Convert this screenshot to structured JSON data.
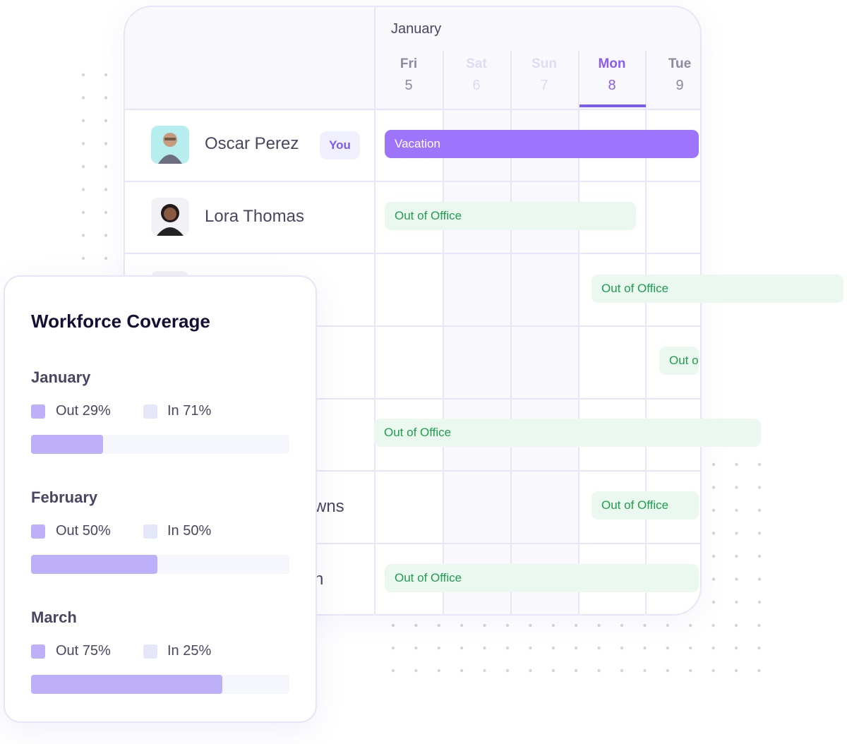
{
  "calendar": {
    "month": "January",
    "days": [
      {
        "name": "Fri",
        "date": "5",
        "type": "weekday"
      },
      {
        "name": "Sat",
        "date": "6",
        "type": "weekend"
      },
      {
        "name": "Sun",
        "date": "7",
        "type": "weekend"
      },
      {
        "name": "Mon",
        "date": "8",
        "type": "today"
      },
      {
        "name": "Tue",
        "date": "9",
        "type": "weekday"
      }
    ],
    "you_badge": "You",
    "people": [
      {
        "name": "Oscar Perez",
        "avatar_bg": "#b6eef0",
        "event": "Vacation",
        "event_type": "vacation"
      },
      {
        "name": "Lora Thomas",
        "avatar_bg": "#f1f1f6",
        "event": "Out of Office",
        "event_type": "ooo"
      },
      {
        "name": "",
        "event": "Out of Office",
        "event_type": "ooo"
      },
      {
        "name": "",
        "event": "Out of Office",
        "event_type": "ooo"
      },
      {
        "name": "",
        "event": "Out of Office",
        "event_type": "ooo"
      },
      {
        "name": "wns",
        "event": "Out of Office",
        "event_type": "ooo"
      },
      {
        "name": "n",
        "event": "Out of Office",
        "event_type": "ooo"
      }
    ]
  },
  "coverage": {
    "title": "Workforce Coverage",
    "months": [
      {
        "label": "January",
        "out_label": "Out 29%",
        "in_label": "In 71%",
        "out_pct": 29
      },
      {
        "label": "February",
        "out_label": "Out 50%",
        "in_label": "In 50%",
        "out_pct": 50
      },
      {
        "label": "March",
        "out_label": "Out 75%",
        "in_label": "In 25%",
        "out_pct": 75
      }
    ]
  },
  "colors": {
    "accent": "#8b5cf6",
    "vacation": "#9d74fb",
    "ooo_bg": "#ebf8f0",
    "ooo_text": "#1f9d4e",
    "out_swatch": "#bdb0f9",
    "in_swatch": "#e4e6fa"
  }
}
